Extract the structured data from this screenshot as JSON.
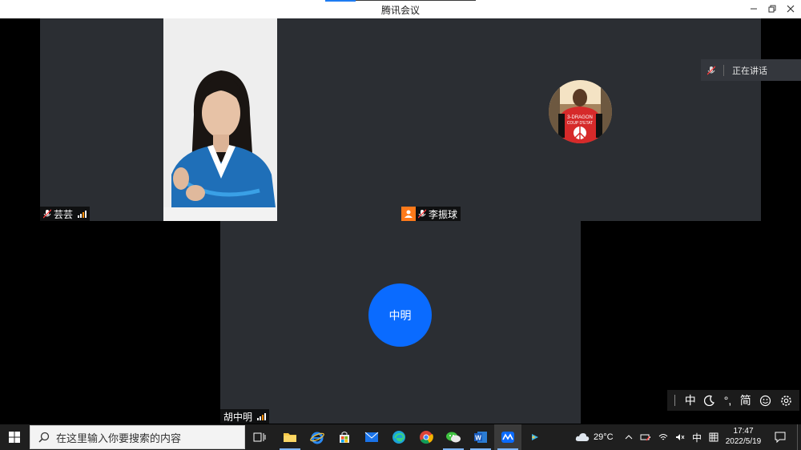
{
  "window": {
    "title": "腾讯会议"
  },
  "participants": {
    "yunyun": {
      "name": "芸芸"
    },
    "li_zhenqiu": {
      "name": "李振球"
    },
    "hu_zhongming": {
      "name": "胡中明",
      "avatar_text": "中明"
    }
  },
  "status_pill": {
    "text": "正在讲话"
  },
  "ime_bar": {
    "mode": "中",
    "punct": "°,",
    "charset": "简"
  },
  "taskbar": {
    "search_placeholder": "在这里输入你要搜索的内容",
    "weather": "29°C",
    "ime": "中",
    "time": "17:47",
    "date": "2022/5/19"
  },
  "colors": {
    "tile_bg": "#2b2e33",
    "avatar_blue": "#0a6bff",
    "taskbar_bg": "#1f1f1f"
  }
}
